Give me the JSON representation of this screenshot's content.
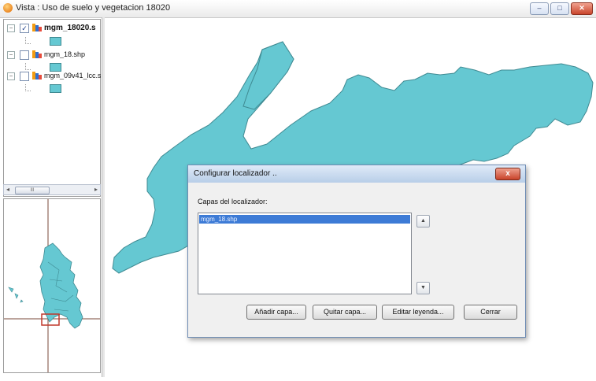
{
  "window": {
    "title": "Vista : Uso de suelo y vegetacion 18020",
    "minimize_icon": "minimize-icon",
    "maximize_icon": "maximize-icon",
    "close_icon": "close-icon"
  },
  "toc": {
    "layers": [
      {
        "name": "mgm_18020.s",
        "checked": true,
        "bold": true
      },
      {
        "name": "mgm_18.shp",
        "checked": false,
        "bold": false
      },
      {
        "name": "mgm_09v41_lcc.s",
        "checked": false,
        "bold": false
      }
    ],
    "scrollbar_thumb_label": "III"
  },
  "colors": {
    "polygon_fill": "#65c8d2",
    "polygon_stroke": "#3f8a92",
    "locator_extent": "#c0392b"
  },
  "dialog": {
    "title": "Configurar localizador ..",
    "close_label": "x",
    "list_label": "Capas del localizador:",
    "list_items": [
      "mgm_18.shp"
    ],
    "buttons": {
      "add": "Añadir capa...",
      "remove": "Quitar capa...",
      "legend": "Editar leyenda...",
      "close": "Cerrar"
    }
  }
}
